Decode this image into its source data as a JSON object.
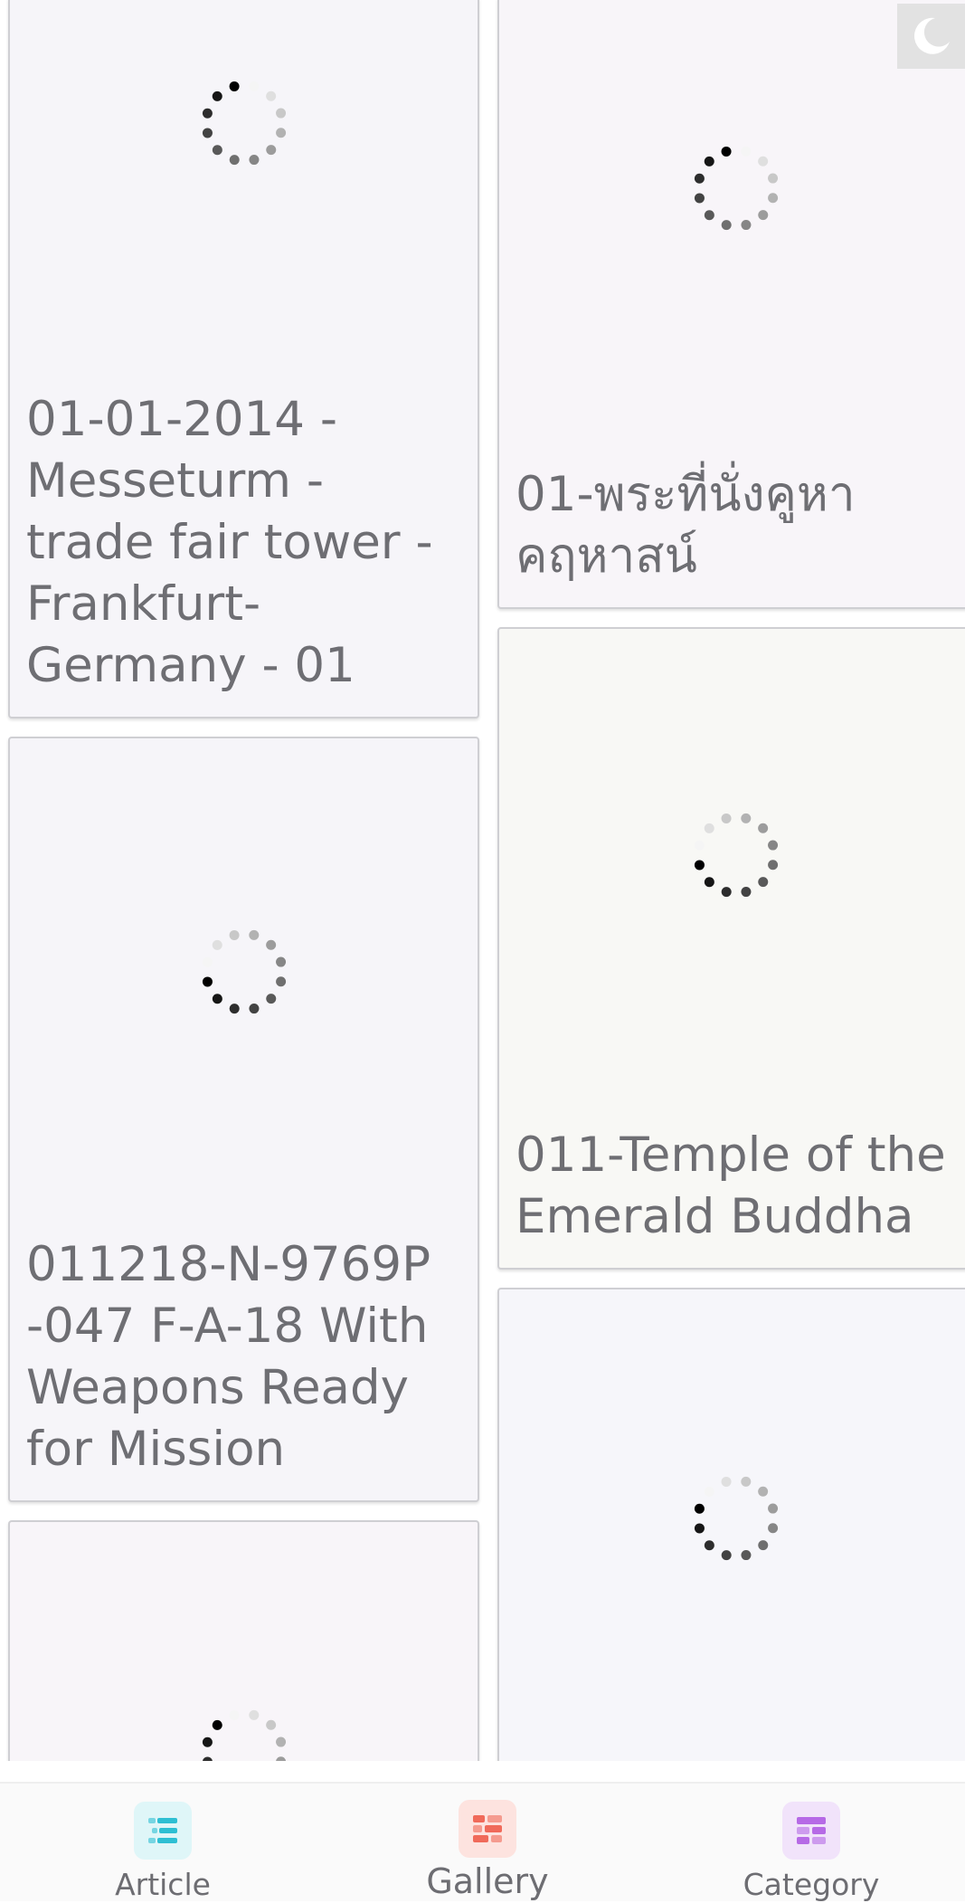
{
  "header": {
    "theme_toggle_icon": "moon-icon"
  },
  "gallery": {
    "left_column": [
      {
        "title": "01-01-2014 - Messeturm - trade fair tower - Frankfurt- Germany - 01",
        "loading": true,
        "background": "#f6f5f9"
      },
      {
        "title": "011218-N-9769P -047 F-A-18 With Weapons Ready for Mission",
        "loading": true,
        "background": "#f6f5f9"
      },
      {
        "title": "",
        "loading": true,
        "background": "#f8f5f9"
      }
    ],
    "right_column": [
      {
        "title": "01-พระที่นั่งคูหาคฤหาสน์",
        "loading": true,
        "background": "#f8f5f9"
      },
      {
        "title": "011-Temple of the Emerald Buddha",
        "loading": true,
        "background": "#f8f8f5"
      },
      {
        "title": "",
        "loading": true,
        "background": "#f6f6fa"
      }
    ]
  },
  "bottom_nav": {
    "items": [
      {
        "label": "Article",
        "icon": "article-list-icon",
        "icon_bg": "#dff6f8",
        "icon_color": "#2ebfd3",
        "active": false
      },
      {
        "label": "Gallery",
        "icon": "gallery-grid-icon",
        "icon_bg": "#fde3df",
        "icon_color": "#f06a5a",
        "active": true
      },
      {
        "label": "Category",
        "icon": "category-icon",
        "icon_bg": "#f1e3fa",
        "icon_color": "#b66ae6",
        "active": false
      }
    ]
  }
}
